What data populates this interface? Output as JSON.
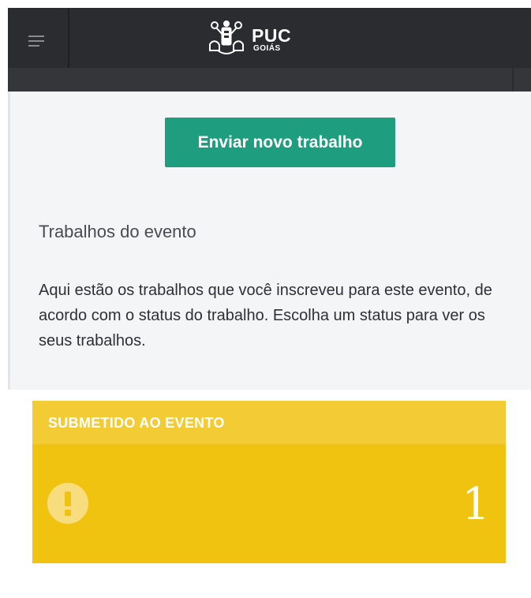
{
  "header": {
    "logo_main": "PUC",
    "logo_sub": "GOIÁS",
    "menu_icon": "hamburger-menu-icon",
    "background_color": "#2b2c30"
  },
  "main": {
    "new_button_label": "Enviar novo trabalho",
    "new_button_color": "#1e9e7e",
    "section_title": "Trabalhos do evento",
    "section_description": "Aqui estão os trabalhos que você inscreveu para este evento, de acordo com o status do trabalho. Escolha um status para ver os seus trabalhos."
  },
  "status_cards": [
    {
      "label": "SUBMETIDO AO EVENTO",
      "count": "1",
      "icon": "exclamation-circle-icon",
      "color": "#f0c311"
    }
  ]
}
